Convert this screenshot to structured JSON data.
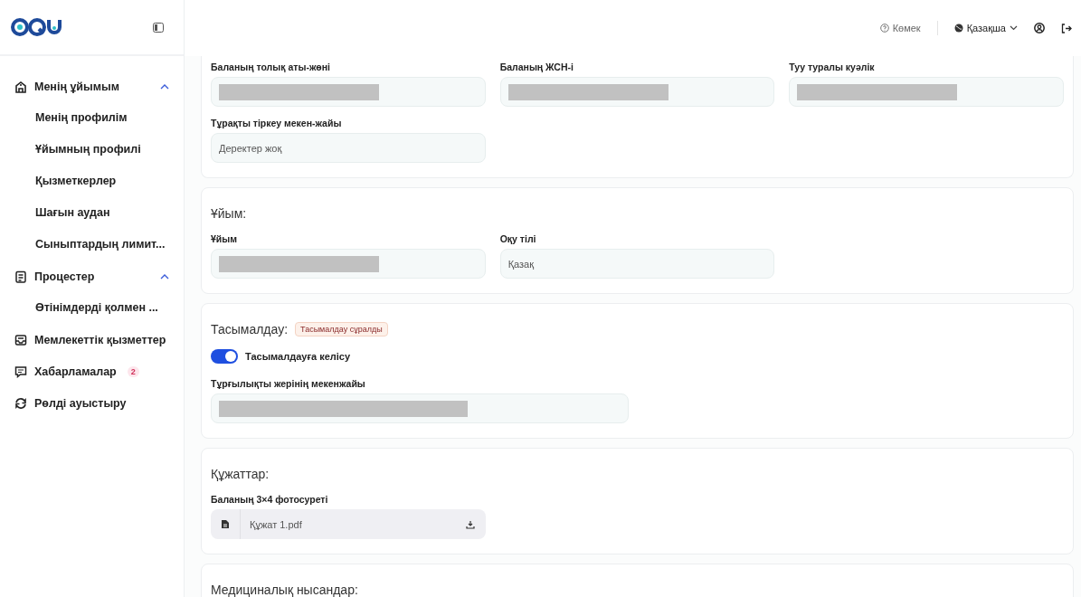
{
  "header": {
    "help": "Көмек",
    "language": "Қазақша"
  },
  "sidebar": {
    "items": [
      {
        "label": "Менің ұйымым",
        "kind": "building",
        "expanded": true,
        "children": [
          {
            "label": "Менің профилім"
          },
          {
            "label": "Ұйымның профилі"
          },
          {
            "label": "Қызметкерлер"
          },
          {
            "label": "Шағын аудан"
          },
          {
            "label": "Сыныптардың лимит..."
          }
        ]
      },
      {
        "label": "Процестер",
        "kind": "clipboard",
        "expanded": true,
        "children": [
          {
            "label": "Өтінімдерді қолмен ..."
          }
        ]
      },
      {
        "label": "Мемлекеттік қызметтер",
        "kind": "tray"
      },
      {
        "label": "Хабарламалар",
        "kind": "chat",
        "badge": "2"
      },
      {
        "label": "Рөлді ауыстыру",
        "kind": "swap"
      }
    ]
  },
  "sections": [
    {
      "kind": "fields",
      "fields": [
        {
          "label": "Баланың толық аты-жөні",
          "redacted": true
        },
        {
          "label": "Баланың ЖСН-і",
          "redacted": true
        },
        {
          "label": "Туу туралы куәлік",
          "redacted": true
        },
        {
          "label": "Тұрақты тіркеу мекен-жайы",
          "value": "Деректер жоқ"
        }
      ]
    },
    {
      "kind": "fields",
      "title": "Ұйым:",
      "fields": [
        {
          "label": "Ұйым",
          "redacted": true
        },
        {
          "label": "Оқу тілі",
          "value": "Қазақ"
        }
      ]
    },
    {
      "kind": "transport",
      "title": "Тасымалдау:",
      "tag": "Тасымалдау сұралды",
      "toggle": {
        "label": "Тасымалдауға келісу",
        "on": true
      },
      "fields": [
        {
          "label": "Тұрғылықты жерінің мекенжайы",
          "redacted": true
        }
      ]
    },
    {
      "kind": "files",
      "title": "Құжаттар:",
      "files": [
        {
          "label": "Баланың 3×4 фотосуреті",
          "name": "Құжат 1.pdf"
        }
      ]
    },
    {
      "kind": "fields",
      "title": "Медициналық нысандар:"
    }
  ]
}
